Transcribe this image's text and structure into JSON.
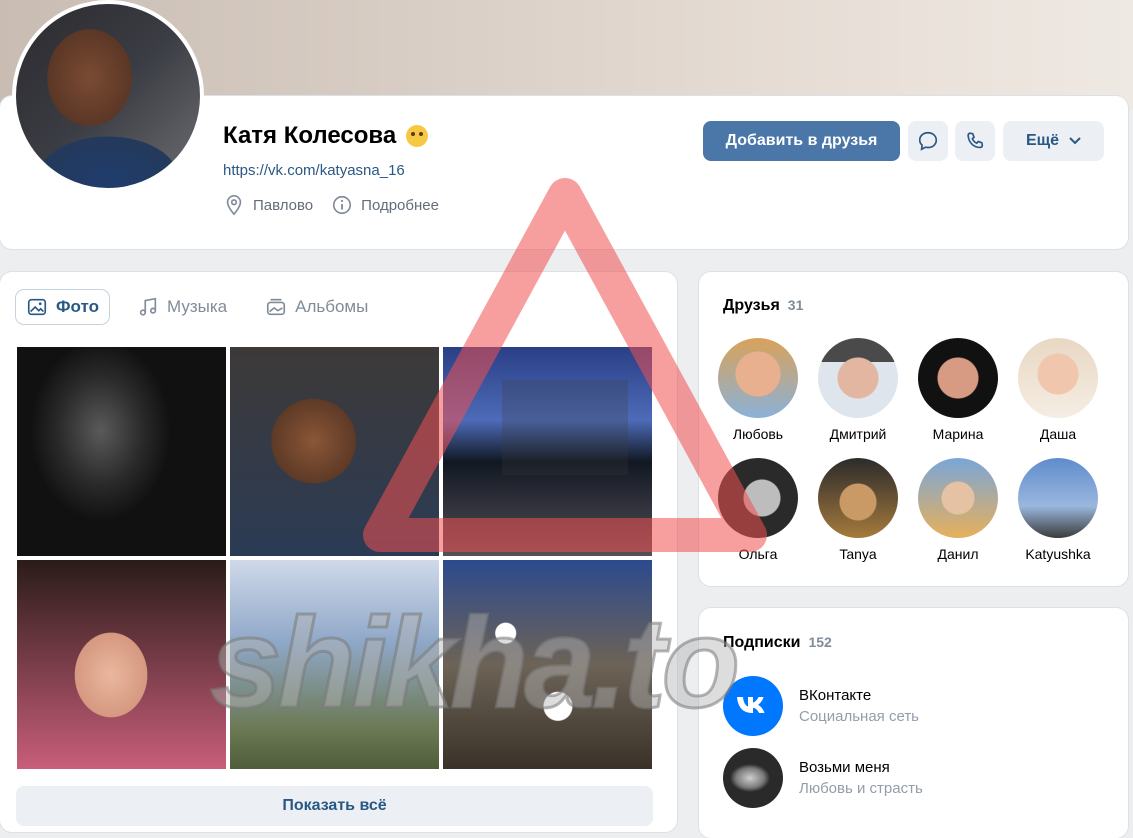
{
  "profile": {
    "name": "Катя Колесова",
    "link": "https://vk.com/katyasna_16",
    "location": "Павлово",
    "details": "Подробнее"
  },
  "actions": {
    "add_friend": "Добавить в друзья",
    "more": "Ещё"
  },
  "photos": {
    "tabs": [
      "Фото",
      "Музыка",
      "Альбомы"
    ],
    "show_all": "Показать всё"
  },
  "friends": {
    "title": "Друзья",
    "count": "31",
    "list": [
      "Любовь",
      "Дмитрий",
      "Марина",
      "Даша",
      "Ольга",
      "Tanya",
      "Данил",
      "Katyushka"
    ]
  },
  "subscriptions": {
    "title": "Подписки",
    "count": "152",
    "items": [
      {
        "name": "ВКонтакте",
        "desc": "Социальная сеть"
      },
      {
        "name": "Возьми меня",
        "desc": "Любовь и страсть"
      }
    ]
  },
  "watermark": "shikha.to",
  "colors": {
    "accent": "#4a76a8",
    "link": "#2a5885",
    "background": "#edeef0"
  }
}
